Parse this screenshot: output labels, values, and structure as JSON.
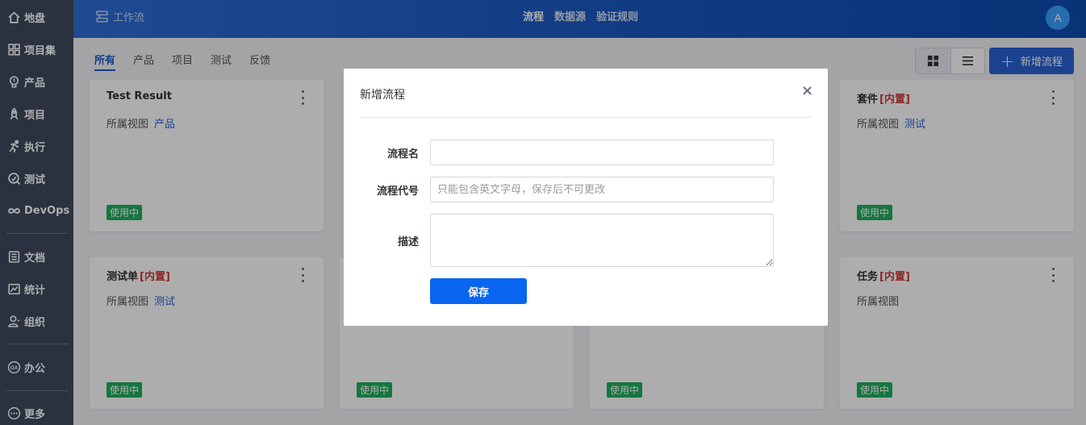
{
  "sidebar": {
    "items": [
      {
        "label": "地盘",
        "icon": "home-icon"
      },
      {
        "label": "项目集",
        "icon": "grid-icon"
      },
      {
        "label": "产品",
        "icon": "lightbulb-icon"
      },
      {
        "label": "项目",
        "icon": "rocket-icon"
      },
      {
        "label": "执行",
        "icon": "run-icon"
      },
      {
        "label": "测试",
        "icon": "search-icon"
      },
      {
        "label": "DevOps",
        "icon": "infinity-icon"
      },
      {
        "label": "文档",
        "icon": "document-icon"
      },
      {
        "label": "统计",
        "icon": "chart-icon"
      },
      {
        "label": "组织",
        "icon": "user-icon"
      },
      {
        "label": "办公",
        "icon": "oa-icon"
      },
      {
        "label": "更多",
        "icon": "more-icon"
      }
    ]
  },
  "header": {
    "app_title": "工作流",
    "tabs": [
      "流程",
      "数据源",
      "验证规则"
    ],
    "active_tab": "流程",
    "avatar_letter": "A"
  },
  "filters": {
    "items": [
      "所有",
      "产品",
      "项目",
      "测试",
      "反馈"
    ],
    "active": "所有"
  },
  "toolbar": {
    "new_button": "新增流程"
  },
  "cards": [
    {
      "name": "Test Result",
      "tag": "",
      "view_label": "所属视图",
      "view": "产品",
      "status": "使用中"
    },
    {
      "name": "套件",
      "tag": "[内置]",
      "view_label": "所属视图",
      "view": "测试",
      "status": "使用中"
    },
    {
      "name": "测试单",
      "tag": "[内置]",
      "view_label": "所属视图",
      "view": "测试",
      "status": "使用中"
    },
    {
      "name": "",
      "tag": "",
      "view_label": "",
      "view": "",
      "status": "使用中"
    },
    {
      "name": "",
      "tag": "",
      "view_label": "",
      "view": "",
      "status": "使用中"
    },
    {
      "name": "任务",
      "tag": "[内置]",
      "view_label": "所属视图",
      "view": "",
      "status": "使用中"
    }
  ],
  "modal": {
    "title": "新增流程",
    "close": "×",
    "fields": {
      "name_label": "流程名",
      "name_value": "",
      "code_label": "流程代号",
      "code_placeholder": "只能包含英文字母，保存后不可更改",
      "desc_label": "描述",
      "desc_value": ""
    },
    "save_label": "保存"
  },
  "colors": {
    "sidebar_bg": "#3e4a5f",
    "header_blue": "#1d5bc4",
    "primary": "#0a66f0",
    "status_green": "#1fae5d",
    "builtin_red": "#d13b3b"
  }
}
